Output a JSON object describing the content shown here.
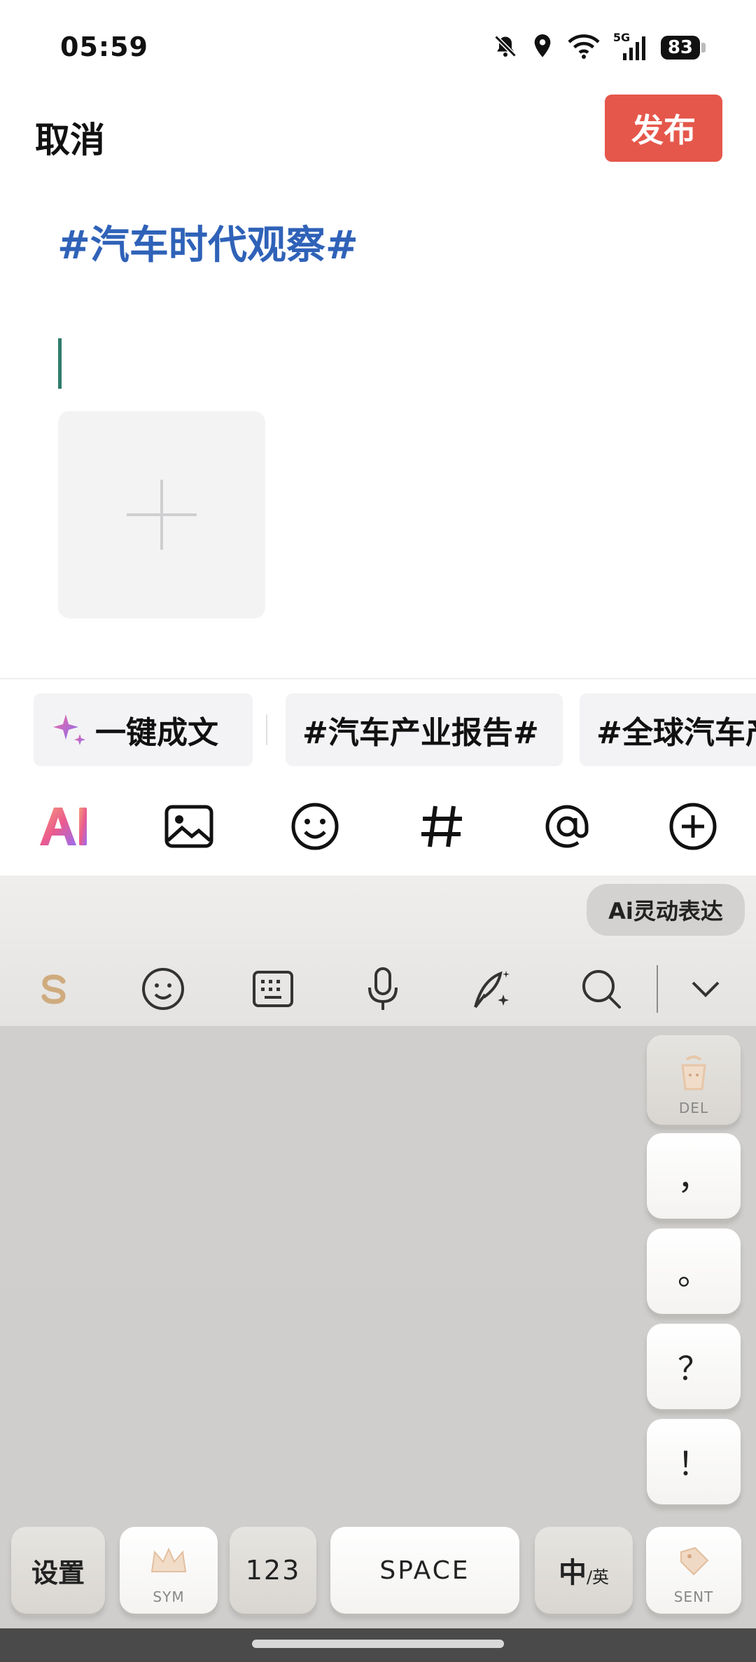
{
  "status_bar": {
    "time": "05:59",
    "network": "5G",
    "battery": "83",
    "icons": [
      "bell-off-icon",
      "location-icon",
      "wifi-icon",
      "signal-icon",
      "battery-icon"
    ]
  },
  "header": {
    "cancel_label": "取消",
    "publish_label": "发布",
    "publish_color": "#e5574b"
  },
  "editor": {
    "topic_tag": "#汽车时代观察#",
    "topic_color": "#2f62b8",
    "add_image_icon": "plus-icon"
  },
  "suggestions": {
    "ai_write_label": "一键成文",
    "hashtags": [
      "#汽车产业报告#",
      "#全球汽车产业报告#"
    ]
  },
  "toolbar": {
    "icons": [
      "ai-icon",
      "image-icon",
      "emoji-icon",
      "hashtag-icon",
      "mention-icon",
      "add-circle-icon"
    ]
  },
  "keyboard": {
    "ai_expression_label": "Ai灵动表达",
    "tool_icons": [
      "sogou-logo-icon",
      "emoji-icon",
      "keyboard-icon",
      "microphone-icon",
      "handwriting-icon",
      "search-icon",
      "collapse-icon"
    ],
    "side_keys": [
      {
        "label": "",
        "sub": "DEL",
        "icon": "delete-icon"
      },
      {
        "label": "，",
        "sub": ""
      },
      {
        "label": "。",
        "sub": ""
      },
      {
        "label": "？",
        "sub": ""
      },
      {
        "label": "！",
        "sub": ""
      }
    ],
    "bottom_keys": {
      "settings": "设置",
      "sym": "SYM",
      "num": "123",
      "space": "SPACE",
      "lang_main": "中",
      "lang_sub": "/英",
      "sent": "SENT"
    }
  }
}
